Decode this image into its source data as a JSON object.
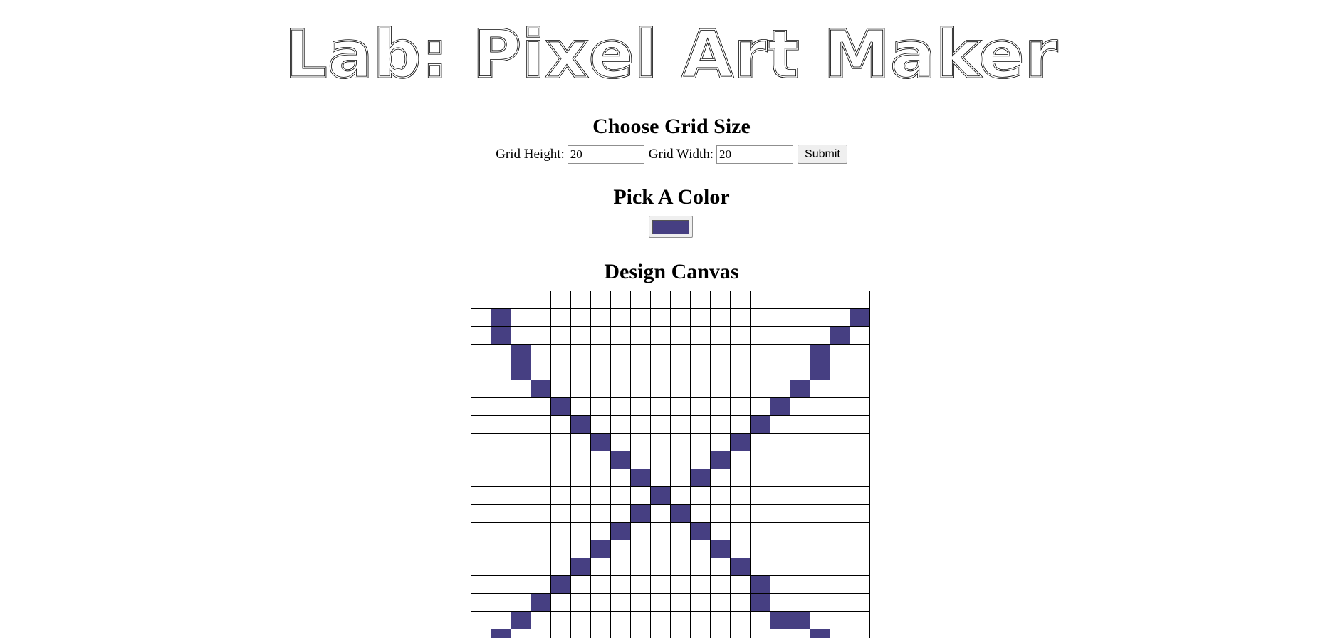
{
  "header": {
    "title": "Lab: Pixel Art Maker"
  },
  "grid_size": {
    "heading": "Choose Grid Size",
    "height_label": "Grid Height:",
    "height_value": "20",
    "width_label": "Grid Width:",
    "width_value": "20",
    "submit_label": "Submit"
  },
  "color_picker": {
    "heading": "Pick A Color",
    "selected_color": "#463f82"
  },
  "design_canvas": {
    "heading": "Design Canvas",
    "rows": 20,
    "cols": 20,
    "filled_cells": [
      [
        1,
        1
      ],
      [
        1,
        19
      ],
      [
        2,
        1
      ],
      [
        2,
        18
      ],
      [
        3,
        2
      ],
      [
        3,
        17
      ],
      [
        4,
        2
      ],
      [
        4,
        17
      ],
      [
        5,
        3
      ],
      [
        5,
        16
      ],
      [
        6,
        4
      ],
      [
        6,
        15
      ],
      [
        7,
        5
      ],
      [
        7,
        14
      ],
      [
        8,
        6
      ],
      [
        8,
        13
      ],
      [
        9,
        7
      ],
      [
        9,
        12
      ],
      [
        10,
        8
      ],
      [
        10,
        11
      ],
      [
        11,
        9
      ],
      [
        12,
        8
      ],
      [
        12,
        10
      ],
      [
        13,
        7
      ],
      [
        13,
        11
      ],
      [
        14,
        6
      ],
      [
        14,
        12
      ],
      [
        15,
        5
      ],
      [
        15,
        13
      ],
      [
        16,
        4
      ],
      [
        16,
        14
      ],
      [
        17,
        3
      ],
      [
        17,
        14
      ],
      [
        18,
        2
      ],
      [
        18,
        15
      ],
      [
        18,
        16
      ],
      [
        19,
        1
      ],
      [
        19,
        17
      ]
    ]
  }
}
